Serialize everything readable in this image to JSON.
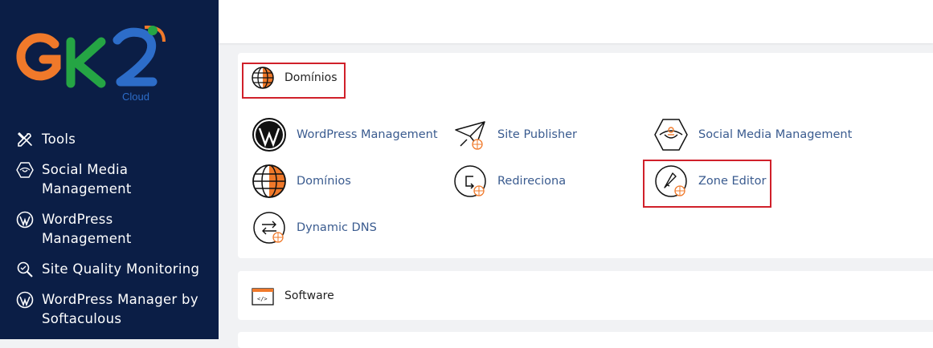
{
  "brand": {
    "logo_text": "GK2",
    "logo_sub": "Cloud",
    "colors": {
      "orange": "#f0792a",
      "green": "#25a544",
      "blue": "#2d6dc9",
      "sidebar": "#0b1e46",
      "link": "#3a5b8f",
      "highlight": "#d0202a"
    }
  },
  "sidebar": {
    "items": [
      {
        "label": "Tools",
        "icon": "tools-icon"
      },
      {
        "label": "Social Media Management",
        "icon": "social-media-icon"
      },
      {
        "label": "WordPress Management",
        "icon": "wordpress-icon"
      },
      {
        "label": "Site Quality Monitoring",
        "icon": "search-icon"
      },
      {
        "label": "WordPress Manager by Softaculous",
        "icon": "wordpress-icon"
      }
    ]
  },
  "panels": {
    "domains": {
      "title": "Domínios",
      "apps": [
        {
          "label": "WordPress Management",
          "icon": "wordpress-icon"
        },
        {
          "label": "Site Publisher",
          "icon": "paper-plane-icon"
        },
        {
          "label": "Social Media Management",
          "icon": "social-media-icon"
        },
        {
          "label": "Domínios",
          "icon": "globe-icon"
        },
        {
          "label": "Redireciona",
          "icon": "redirect-icon"
        },
        {
          "label": "Zone Editor",
          "icon": "zone-editor-icon"
        },
        {
          "label": "Dynamic DNS",
          "icon": "dynamic-dns-icon"
        }
      ]
    },
    "software": {
      "title": "Software"
    }
  }
}
